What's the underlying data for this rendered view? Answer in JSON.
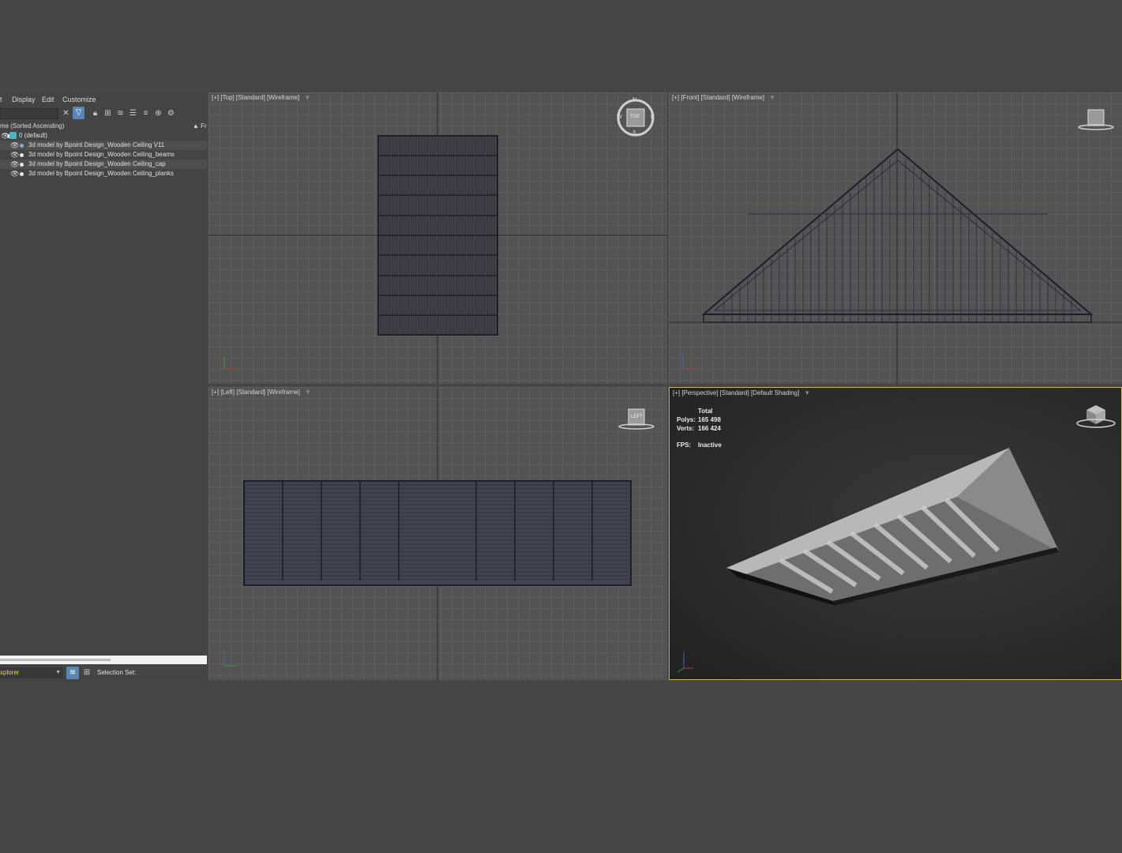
{
  "menu": {
    "item0": "t",
    "display": "Display",
    "edit": "Edit",
    "customize": "Customize"
  },
  "explorer": {
    "column_header": "me (Sorted Ascending)",
    "column_right": "▲ Fr",
    "rows": [
      {
        "label": "0 (default)"
      },
      {
        "label": "3d model by Bpoint Design_Wooden Ceiling V11"
      },
      {
        "label": "3d model by Bpoint Design_Wooden Ceiling_beams"
      },
      {
        "label": "3d model by Bpoint Design_Wooden Ceiling_cap"
      },
      {
        "label": "3d model by Bpoint Design_Wooden Ceiling_planks"
      }
    ],
    "explorer_selector": "xplorer",
    "selection_set_label": "Selection Set:"
  },
  "viewports": {
    "top": {
      "label": "[+] [Top] [Standard] [Wireframe]"
    },
    "front": {
      "label": "[+] [Front] [Standard] [Wireframe]"
    },
    "left": {
      "label": "[+] [Left] [Standard] [Wireframe]"
    },
    "perspective": {
      "label": "[+] [Perspective] [Standard] [Default Shading]"
    }
  },
  "stats": {
    "total_label": "Total",
    "polys_label": "Polys:",
    "polys_value": "165 498",
    "verts_label": "Verts:",
    "verts_value": "166 424",
    "fps_label": "FPS:",
    "fps_value": "Inactive"
  },
  "viewcube": {
    "top_face": "TOP",
    "left_face": "LEFT",
    "compass_n": "N",
    "compass_s": "S",
    "compass_w": "W",
    "compass_e": "E"
  },
  "colors": {
    "active_border": "#c8b45a",
    "accent_blue": "#5a86b5",
    "layer_icon": "#4fb3c4",
    "selection_text": "#e8d84b"
  }
}
